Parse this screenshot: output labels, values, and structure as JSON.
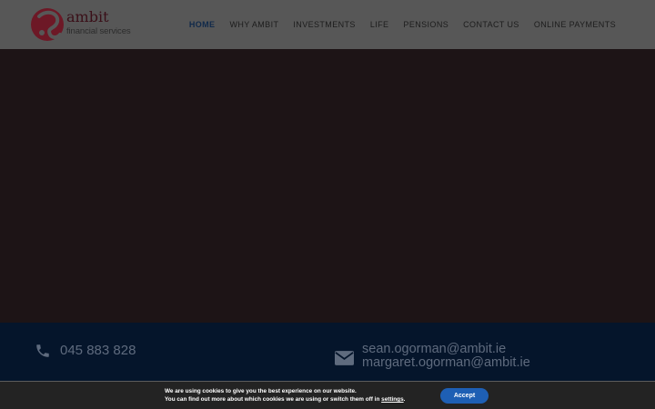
{
  "brand": {
    "name": "ambit",
    "tagline": "financial services"
  },
  "nav": {
    "items": [
      {
        "label": "HOME",
        "active": true
      },
      {
        "label": "WHY AMBIT",
        "active": false
      },
      {
        "label": "INVESTMENTS",
        "active": false
      },
      {
        "label": "LIFE",
        "active": false
      },
      {
        "label": "PENSIONS",
        "active": false
      },
      {
        "label": "CONTACT US",
        "active": false
      },
      {
        "label": "ONLINE PAYMENTS",
        "active": false
      }
    ]
  },
  "contact": {
    "phone": "045 883 828",
    "emails": [
      "sean.ogorman@ambit.ie",
      "margaret.ogorman@ambit.ie"
    ]
  },
  "cookie": {
    "line1": "We are using cookies to give you the best experience on our website.",
    "line2_prefix": "You can find out more about which cookies we are using or switch them off in ",
    "settings_link": "settings",
    "line2_suffix": ".",
    "accept_label": "Accept"
  },
  "colors": {
    "header_bg": "#575757",
    "hero_bg": "#1d1416",
    "contact_bg": "#05152b",
    "accent_button": "#1e5fb4",
    "logo_red": "#7a1a2a"
  }
}
